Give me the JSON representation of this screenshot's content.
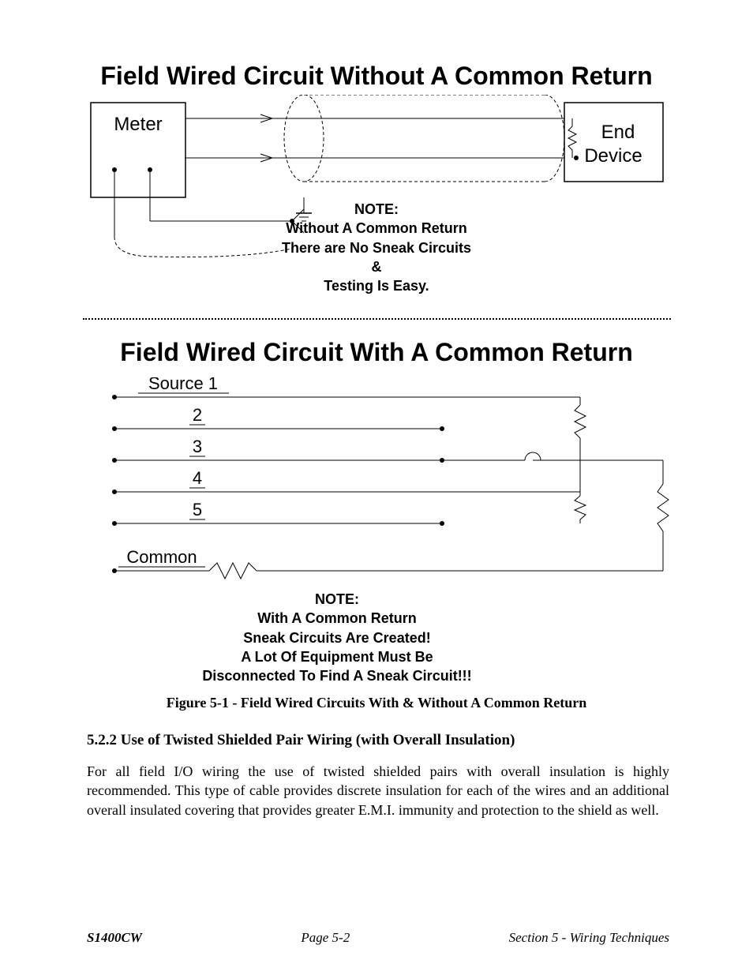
{
  "diagram1": {
    "title": "Field Wired Circuit Without A Common Return",
    "box_left": "Meter",
    "box_right_top": "End",
    "box_right_bottom": "Device",
    "note_heading": "NOTE:",
    "note_l1": "Without A Common Return",
    "note_l2": "There are No Sneak Circuits",
    "note_l3": "&",
    "note_l4": "Testing Is Easy."
  },
  "diagram2": {
    "title": "Field Wired Circuit With A Common Return",
    "line1": "Source 1",
    "line2": "2",
    "line3": "3",
    "line4": "4",
    "line5": "5",
    "line6": "Common",
    "note_heading": "NOTE:",
    "note_l1": "With A Common Return",
    "note_l2": "Sneak Circuits Are Created!",
    "note_l3": "A Lot Of Equipment Must Be",
    "note_l4": "Disconnected To Find A Sneak Circuit!!!"
  },
  "figure_caption": "Figure 5-1 - Field Wired Circuits With & Without A Common Return",
  "section_heading": "5.2.2 Use of Twisted Shielded Pair Wiring  (with Overall Insulation)",
  "body_text": "For all field I/O wiring the use of twisted shielded pairs with overall insulation is highly recommended. This type of cable provides discrete insulation for each of the wires and an additional overall insulated covering that provides greater E.M.I. immunity and protection to the shield as well.",
  "footer": {
    "left": "S1400CW",
    "center": "Page 5-2",
    "right": "Section 5 - Wiring Techniques"
  }
}
